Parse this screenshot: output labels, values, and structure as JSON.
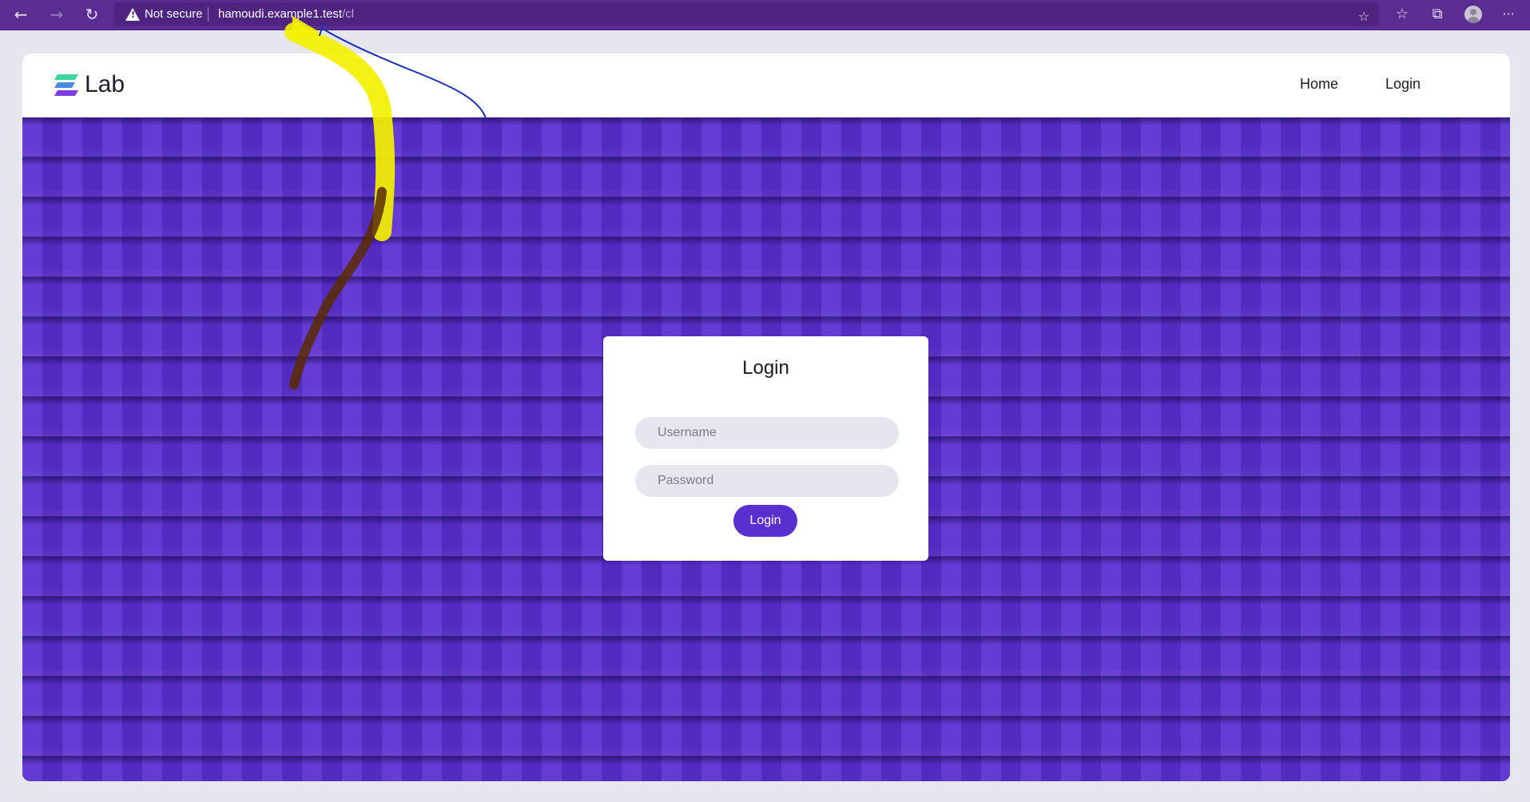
{
  "browser": {
    "back_icon": "arrow-left-icon",
    "forward_icon": "arrow-right-icon",
    "reload_icon": "reload-icon",
    "security_label": "Not secure",
    "url_host": "hamoudi.example1.test",
    "url_path": "/cl",
    "toolbar_icons": [
      "favorite-add-icon",
      "favorites-icon",
      "collections-icon",
      "profile-icon",
      "more-icon"
    ],
    "colors": {
      "toolbar": "#5b2c91",
      "address_bar": "#4e2480"
    }
  },
  "site": {
    "logo_text": "Lab",
    "nav": {
      "home": "Home",
      "login": "Login"
    }
  },
  "login_form": {
    "title": "Login",
    "username_placeholder": "Username",
    "password_placeholder": "Password",
    "submit_label": "Login"
  },
  "theme": {
    "accent": "#5a2fd0",
    "logo_colors": [
      "#3ed3a1",
      "#4a8de0",
      "#7b3fe0"
    ]
  },
  "annotations": {
    "yellow_arrow": "highlighter-arrow",
    "brown_stroke": "pen-stroke",
    "blue_line": "pen-line"
  }
}
